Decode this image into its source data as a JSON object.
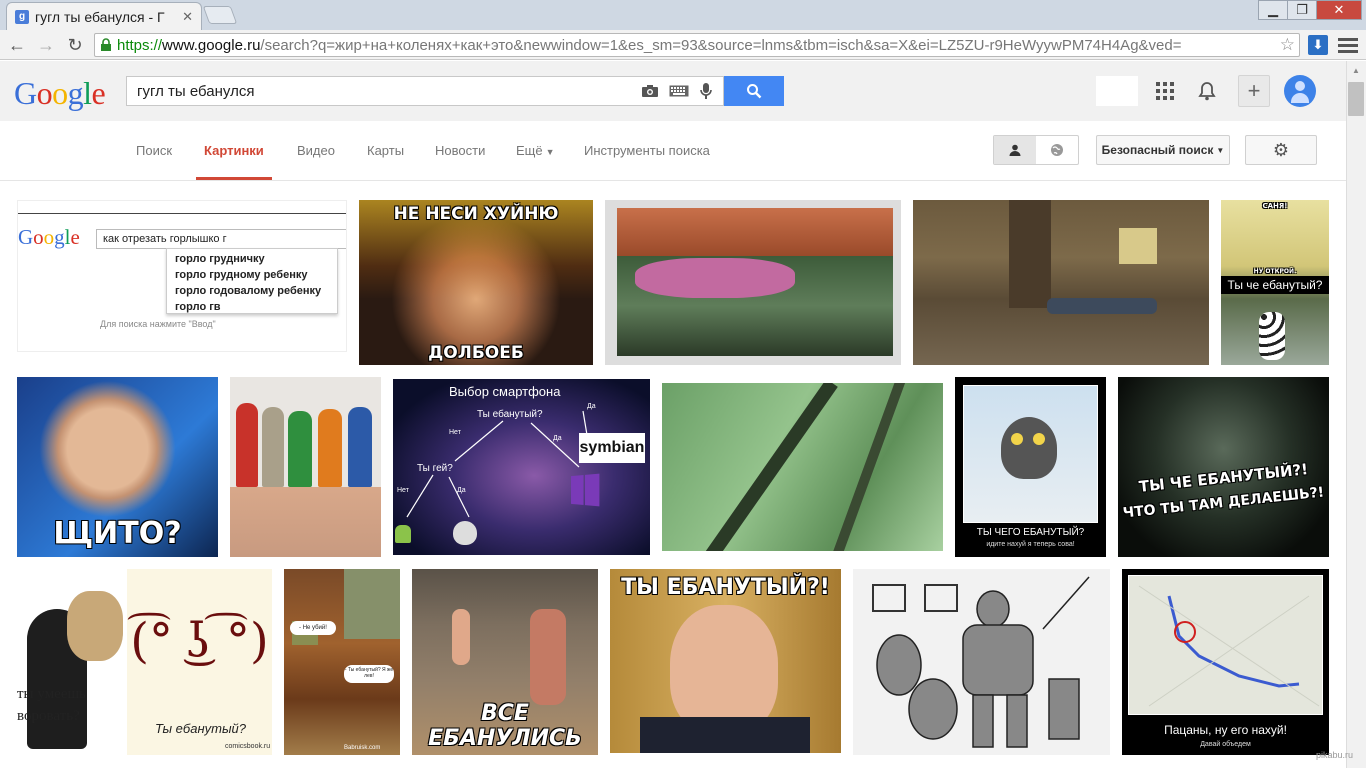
{
  "browser": {
    "tab_title": "гугл ты ебанулся - Г",
    "tab_favicon": "g",
    "url_scheme": "https://",
    "url_host": "www.google.ru",
    "url_rest": "/search?q=жир+на+коленях+как+это&newwindow=1&es_sm=93&source=lnms&tbm=isch&sa=X&ei=LZ5ZU-r9HeWyywPM74H4Ag&ved="
  },
  "google": {
    "logo": [
      "G",
      "o",
      "o",
      "g",
      "l",
      "e"
    ],
    "query": "гугл ты ебанулся"
  },
  "tabs": [
    "Поиск",
    "Картинки",
    "Видео",
    "Карты",
    "Новости",
    "Ещё",
    "Инструменты поиска"
  ],
  "safe_search": "Безопасный поиск",
  "images": {
    "r1_google": {
      "query": "как отрезать горлышко г",
      "suggestions": [
        "горло грудничку",
        "горло грудному ребенку",
        "горло годовалому ребенку",
        "горло гв"
      ],
      "hint": "Для поиска нажмите \"Ввод\""
    },
    "r1_jackie": {
      "top": "НЕ НЕСИ ХУЙНЮ",
      "bottom": "ДОЛБОЕБ"
    },
    "r1_dog": {
      "top": "САНЯ!",
      "mid": "НУ ОТКРОЙ.",
      "bottom": "Ты че ебанутый?"
    },
    "r2_boy": {
      "text": "ЩИТО?"
    },
    "r2_space": {
      "title": "Выбор смартфона",
      "q1": "Ты ебанутый?",
      "q2": "Ты гей?",
      "no": "Нет",
      "yes": "Да",
      "brand": "symbian"
    },
    "r2_cat": {
      "title": "ТЫ ЧЕГО ЕБАНУТЫЙ?",
      "sub": "идите нахуй я теперь сова!"
    },
    "r2_creepy": {
      "line1": "ТЫ ЧЕ ЕБАНУТЫЙ?!",
      "line2": "ЧТО ТЫ ТАМ ДЕЛАЕШЬ?!"
    },
    "r3_thief": {
      "text": "ты умеешь воровать?"
    },
    "r3_lenny": {
      "face": "(͡° ͜ʖ ͡°)",
      "text": "Ты ебанутый?",
      "credit": "comicsbook.ru"
    },
    "r3_paint": {
      "b1": "- Не убий!",
      "b2": "- Ты ебанутый? Я же лев!",
      "credit": "Babruisk.com"
    },
    "r3_village": {
      "text": "ВСЕ ЕБАНУЛИСЬ"
    },
    "r3_putin": {
      "text": "ТЫ ЕБАНУТЫЙ?!"
    },
    "r3_map": {
      "title": "Пацаны, ну его нахуй!",
      "sub": "Давай объедем"
    }
  },
  "watermark": "pikabu.ru"
}
